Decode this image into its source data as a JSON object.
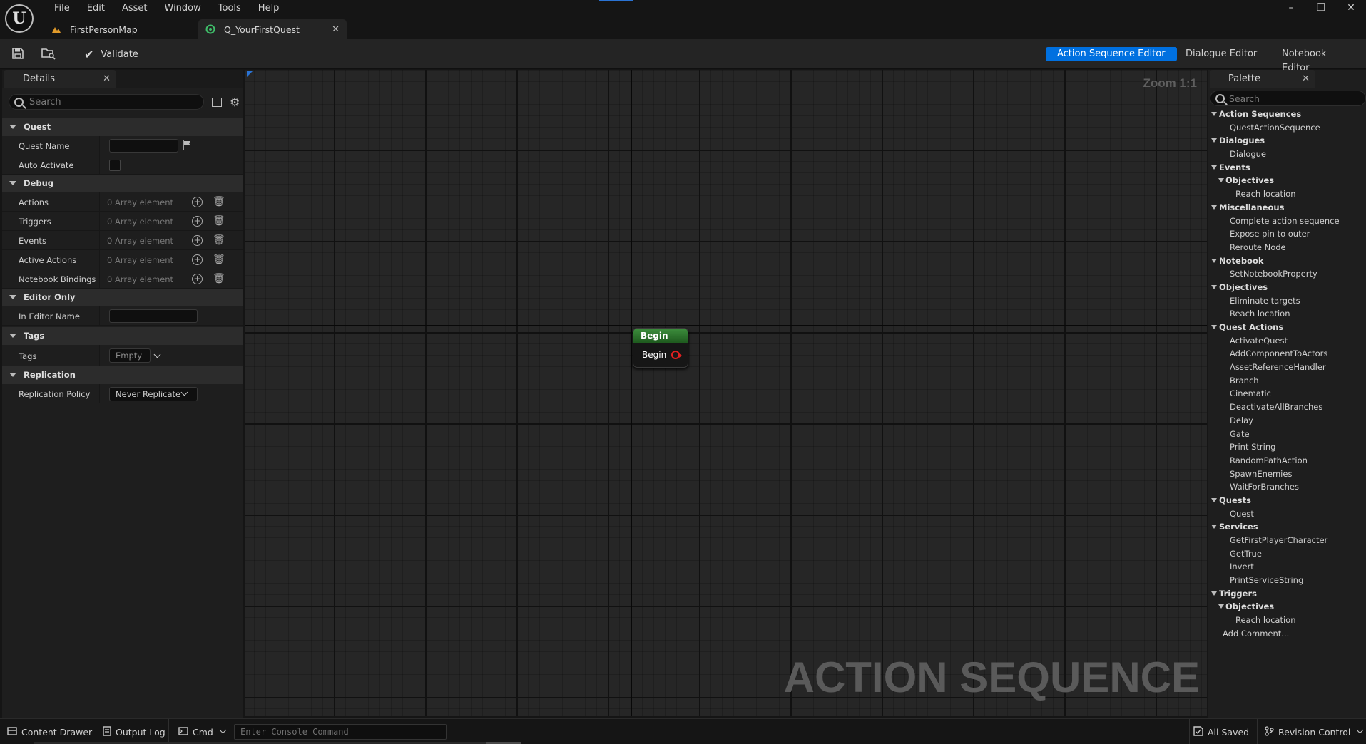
{
  "menu": [
    "File",
    "Edit",
    "Asset",
    "Window",
    "Tools",
    "Help"
  ],
  "tabs": [
    {
      "label": "FirstPersonMap"
    },
    {
      "label": "Q_YourFirstQuest"
    }
  ],
  "toolbar": {
    "validate_label": "Validate",
    "modes": [
      "Action Sequence Editor",
      "Dialogue Editor",
      "Notebook Editor"
    ]
  },
  "details": {
    "title": "Details",
    "search_placeholder": "Search",
    "categories": {
      "quest": "Quest",
      "debug": "Debug",
      "editor_only": "Editor Only",
      "tags": "Tags",
      "replication": "Replication"
    },
    "props": {
      "quest_name": "Quest Name",
      "auto_activate": "Auto Activate",
      "actions": "Actions",
      "triggers": "Triggers",
      "events": "Events",
      "active_actions": "Active Actions",
      "notebook_bindings": "Notebook Bindings",
      "in_editor_name": "In Editor Name",
      "tags": "Tags",
      "replication_policy": "Replication Policy"
    },
    "array_text": "0 Array element",
    "tags_value": "Empty",
    "replication_value": "Never Replicate"
  },
  "graph": {
    "zoom": "Zoom 1:1",
    "watermark": "ACTION SEQUENCE",
    "node_title": "Begin",
    "node_pin": "Begin"
  },
  "palette": {
    "title": "Palette",
    "search_placeholder": "Search",
    "items": [
      {
        "label": "Action Sequences",
        "level": 0,
        "header": true
      },
      {
        "label": "QuestActionSequence",
        "level": 2,
        "header": false
      },
      {
        "label": "Dialogues",
        "level": 0,
        "header": true
      },
      {
        "label": "Dialogue",
        "level": 2,
        "header": false
      },
      {
        "label": "Events",
        "level": 0,
        "header": true
      },
      {
        "label": "Objectives",
        "level": 1,
        "header": true
      },
      {
        "label": "Reach location",
        "level": 3,
        "header": false
      },
      {
        "label": "Miscellaneous",
        "level": 0,
        "header": true
      },
      {
        "label": "Complete action sequence",
        "level": 2,
        "header": false
      },
      {
        "label": "Expose pin to outer",
        "level": 2,
        "header": false
      },
      {
        "label": "Reroute Node",
        "level": 2,
        "header": false
      },
      {
        "label": "Notebook",
        "level": 0,
        "header": true
      },
      {
        "label": "SetNotebookProperty",
        "level": 2,
        "header": false
      },
      {
        "label": "Objectives",
        "level": 0,
        "header": true
      },
      {
        "label": "Eliminate targets",
        "level": 2,
        "header": false
      },
      {
        "label": "Reach location",
        "level": 2,
        "header": false
      },
      {
        "label": "Quest Actions",
        "level": 0,
        "header": true
      },
      {
        "label": "ActivateQuest",
        "level": 2,
        "header": false
      },
      {
        "label": "AddComponentToActors",
        "level": 2,
        "header": false
      },
      {
        "label": "AssetReferenceHandler",
        "level": 2,
        "header": false
      },
      {
        "label": "Branch",
        "level": 2,
        "header": false
      },
      {
        "label": "Cinematic",
        "level": 2,
        "header": false
      },
      {
        "label": "DeactivateAllBranches",
        "level": 2,
        "header": false
      },
      {
        "label": "Delay",
        "level": 2,
        "header": false
      },
      {
        "label": "Gate",
        "level": 2,
        "header": false
      },
      {
        "label": "Print String",
        "level": 2,
        "header": false
      },
      {
        "label": "RandomPathAction",
        "level": 2,
        "header": false
      },
      {
        "label": "SpawnEnemies",
        "level": 2,
        "header": false
      },
      {
        "label": "WaitForBranches",
        "level": 2,
        "header": false
      },
      {
        "label": "Quests",
        "level": 0,
        "header": true
      },
      {
        "label": "Quest",
        "level": 2,
        "header": false
      },
      {
        "label": "Services",
        "level": 0,
        "header": true
      },
      {
        "label": "GetFirstPlayerCharacter",
        "level": 2,
        "header": false
      },
      {
        "label": "GetTrue",
        "level": 2,
        "header": false
      },
      {
        "label": "Invert",
        "level": 2,
        "header": false
      },
      {
        "label": "PrintServiceString",
        "level": 2,
        "header": false
      },
      {
        "label": "Triggers",
        "level": 0,
        "header": true
      },
      {
        "label": "Objectives",
        "level": 1,
        "header": true
      },
      {
        "label": "Reach location",
        "level": 3,
        "header": false
      },
      {
        "label": "Add Comment...",
        "level": 4,
        "header": false
      }
    ]
  },
  "statusbar": {
    "content_drawer": "Content Drawer",
    "output_log": "Output Log",
    "cmd": "Cmd",
    "console_placeholder": "Enter Console Command",
    "all_saved": "All Saved",
    "revision_control": "Revision Control"
  }
}
